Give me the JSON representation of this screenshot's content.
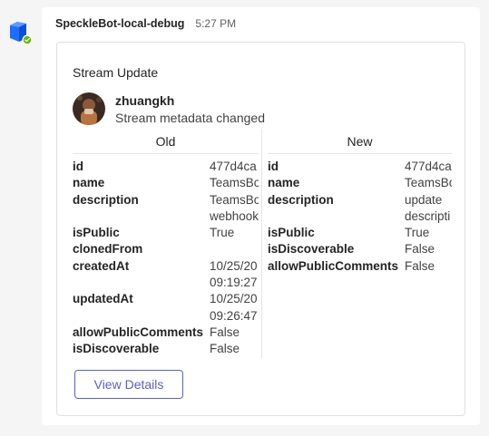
{
  "message": {
    "sender": "SpeckleBot-local-debug",
    "timestamp": "5:27 PM",
    "bot_avatar_icon": "speckle-cube-icon",
    "status_icon": "available-check-icon"
  },
  "card": {
    "title": "Stream Update",
    "author": {
      "name": "zhuangkh",
      "subtitle": "Stream metadata changed",
      "avatar_icon": "user-photo"
    },
    "old": {
      "heading": "Old",
      "rows": [
        {
          "key": "id",
          "value": "477d4ca",
          "value2": ""
        },
        {
          "key": "name",
          "value": "TeamsBo",
          "value2": ""
        },
        {
          "key": "description",
          "value": "TeamsBo",
          "value2": "webhook"
        },
        {
          "key": "isPublic",
          "value": "True",
          "value2": ""
        },
        {
          "key": "clonedFrom",
          "value": "",
          "value2": ""
        },
        {
          "key": "createdAt",
          "value": "10/25/20",
          "value2": "09:19:27"
        },
        {
          "key": "updatedAt",
          "value": "10/25/20",
          "value2": "09:26:47"
        },
        {
          "key": "allowPublicComments",
          "value": "False",
          "value2": ""
        },
        {
          "key": "isDiscoverable",
          "value": "False",
          "value2": ""
        }
      ]
    },
    "new": {
      "heading": "New",
      "rows": [
        {
          "key": "id",
          "value": "477d4ca",
          "value2": ""
        },
        {
          "key": "name",
          "value": "TeamsBo",
          "value2": ""
        },
        {
          "key": "description",
          "value": "update",
          "value2": "descripti"
        },
        {
          "key": "isPublic",
          "value": "True",
          "value2": ""
        },
        {
          "key": "isDiscoverable",
          "value": "False",
          "value2": ""
        },
        {
          "key": "allowPublicComments",
          "value": "False",
          "value2": ""
        }
      ]
    },
    "action_label": "View Details"
  },
  "colors": {
    "accent": "#5b5fc7",
    "bot_blue": "#1e6fff",
    "status_green": "#6bb700"
  }
}
